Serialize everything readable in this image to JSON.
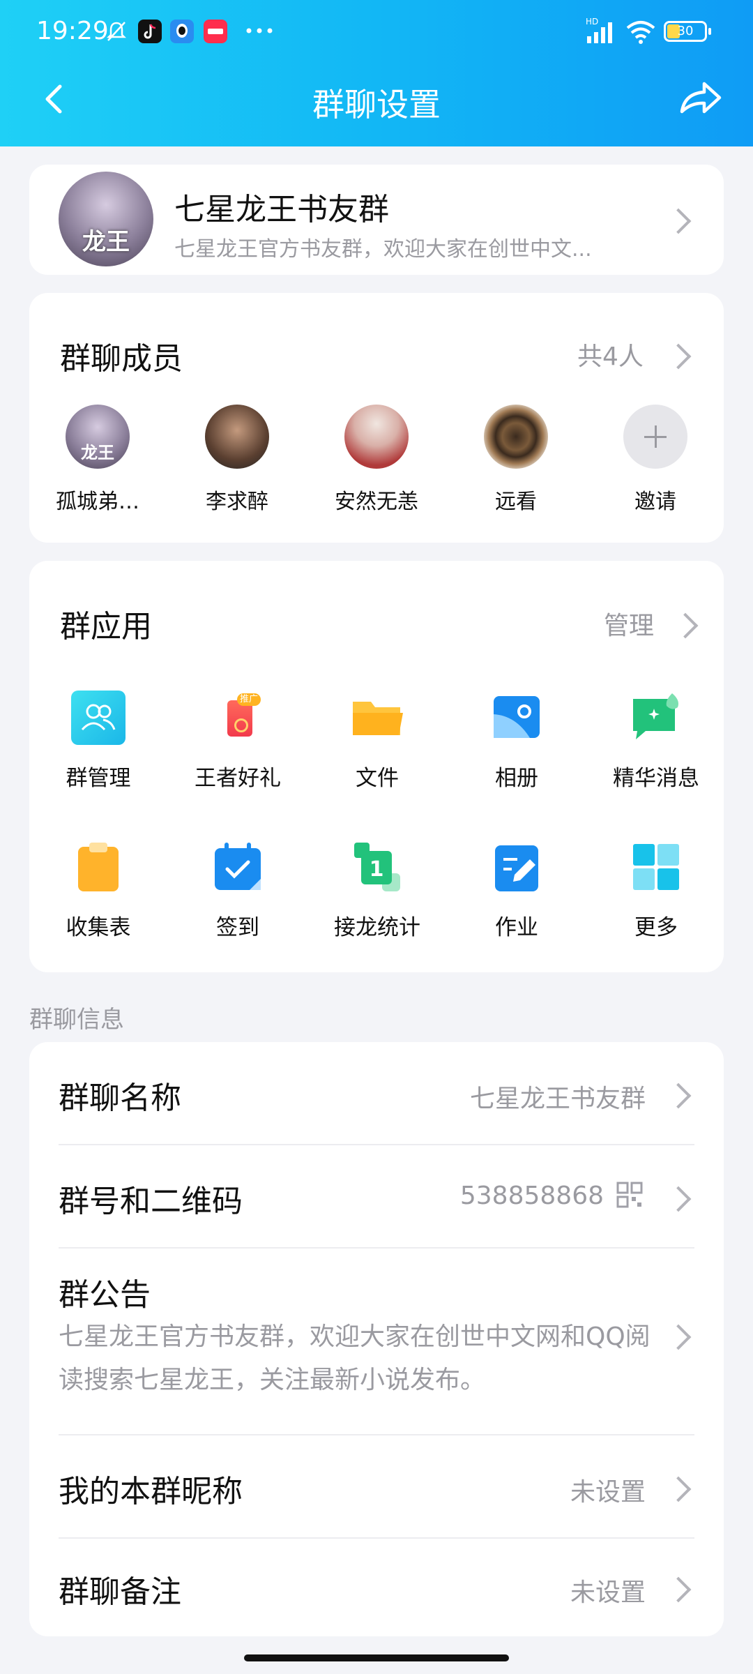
{
  "status_bar": {
    "time": "19:29",
    "battery": "30",
    "network": "HD"
  },
  "header": {
    "title": "群聊设置"
  },
  "group": {
    "avatar_text": "龙王",
    "name": "七星龙王书友群",
    "description": "七星龙王官方书友群，欢迎大家在创世中文..."
  },
  "members": {
    "title": "群聊成员",
    "count": "共4人",
    "list": [
      {
        "name": "孤城弟…",
        "avatar_text": "龙王"
      },
      {
        "name": "李求醉"
      },
      {
        "name": "安然无恙"
      },
      {
        "name": "远看"
      },
      {
        "name": "邀请"
      }
    ]
  },
  "apps": {
    "title": "群应用",
    "manage": "管理",
    "items": [
      {
        "label": "群管理",
        "icon": "group-manage-icon"
      },
      {
        "label": "王者好礼",
        "icon": "gift-icon",
        "badge": "推广"
      },
      {
        "label": "文件",
        "icon": "folder-icon"
      },
      {
        "label": "相册",
        "icon": "album-icon"
      },
      {
        "label": "精华消息",
        "icon": "essence-message-icon"
      },
      {
        "label": "收集表",
        "icon": "clipboard-icon"
      },
      {
        "label": "签到",
        "icon": "calendar-check-icon"
      },
      {
        "label": "接龙统计",
        "icon": "relay-icon",
        "glyph": "1"
      },
      {
        "label": "作业",
        "icon": "homework-icon"
      },
      {
        "label": "更多",
        "icon": "more-grid-icon"
      }
    ]
  },
  "info": {
    "section_label": "群聊信息",
    "name_label": "群聊名称",
    "name_value": "七星龙王书友群",
    "id_label": "群号和二维码",
    "id_value": "538858868",
    "notice_label": "群公告",
    "notice_text": "七星龙王官方书友群，欢迎大家在创世中文网和QQ阅读搜索七星龙王，关注最新小说发布。",
    "nickname_label": "我的本群昵称",
    "nickname_value": "未设置",
    "remark_label": "群聊备注",
    "remark_value": "未设置"
  },
  "colors": {
    "header_start": "#1fd0f6",
    "header_end": "#0f9cf5",
    "accent": "#12b7f5"
  }
}
